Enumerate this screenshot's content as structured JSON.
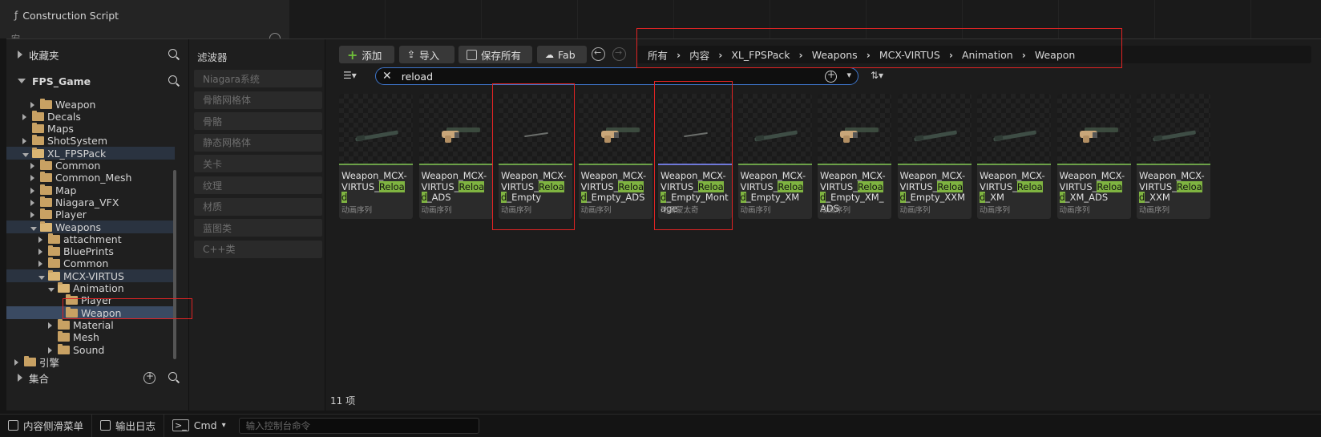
{
  "background": {
    "construction_script": "Construction Script",
    "partial_label": "宏"
  },
  "tree": {
    "favorites": "收藏夹",
    "root": "FPS_Game",
    "rows": [
      {
        "label": "Weapon",
        "indent": 3,
        "arrow": "r",
        "open": false
      },
      {
        "label": "Decals",
        "indent": 2,
        "arrow": "r",
        "open": false
      },
      {
        "label": "Maps",
        "indent": 2,
        "arrow": "",
        "open": false
      },
      {
        "label": "ShotSystem",
        "indent": 2,
        "arrow": "r",
        "open": false
      },
      {
        "label": "XL_FPSPack",
        "indent": 2,
        "arrow": "d",
        "open": true
      },
      {
        "label": "Common",
        "indent": 3,
        "arrow": "r",
        "open": false
      },
      {
        "label": "Common_Mesh",
        "indent": 3,
        "arrow": "r",
        "open": false
      },
      {
        "label": "Map",
        "indent": 3,
        "arrow": "r",
        "open": false
      },
      {
        "label": "Niagara_VFX",
        "indent": 3,
        "arrow": "r",
        "open": false
      },
      {
        "label": "Player",
        "indent": 3,
        "arrow": "r",
        "open": false
      },
      {
        "label": "Weapons",
        "indent": 3,
        "arrow": "d",
        "open": true
      },
      {
        "label": "attachment",
        "indent": 4,
        "arrow": "r",
        "open": false
      },
      {
        "label": "BluePrints",
        "indent": 4,
        "arrow": "r",
        "open": false
      },
      {
        "label": "Common",
        "indent": 4,
        "arrow": "r",
        "open": false
      },
      {
        "label": "MCX-VIRTUS",
        "indent": 4,
        "arrow": "d",
        "open": true
      },
      {
        "label": "Animation",
        "indent": 5,
        "arrow": "d",
        "open": true
      },
      {
        "label": "Player",
        "indent": 6,
        "arrow": "",
        "open": false
      },
      {
        "label": "Weapon",
        "indent": 6,
        "arrow": "",
        "open": false
      },
      {
        "label": "Material",
        "indent": 5,
        "arrow": "r",
        "open": false
      },
      {
        "label": "Mesh",
        "indent": 5,
        "arrow": "",
        "open": false
      },
      {
        "label": "Sound",
        "indent": 5,
        "arrow": "r",
        "open": false
      },
      {
        "label": "引擎",
        "indent": 1,
        "arrow": "r",
        "open": false
      }
    ],
    "collections": "集合"
  },
  "filters": {
    "title": "滤波器",
    "items": [
      "Niagara系统",
      "骨骼网格体",
      "骨骼",
      "静态网格体",
      "关卡",
      "纹理",
      "材质",
      "蓝图类",
      "C++类"
    ]
  },
  "toolbar": {
    "add": "添加",
    "import": "导入",
    "save_all": "保存所有",
    "fab": "Fab"
  },
  "breadcrumbs": [
    "所有",
    "内容",
    "XL_FPSPack",
    "Weapons",
    "MCX-VIRTUS",
    "Animation",
    "Weapon"
  ],
  "search": {
    "value": "reload"
  },
  "assets": [
    {
      "pre": "Weapon_MCX-VIRTUS_",
      "hl": "Reload",
      "post": "",
      "type": "动画序列",
      "gun": "long"
    },
    {
      "pre": "Weapon_MCX-VIRTUS_",
      "hl": "Reload",
      "post": "_ADS",
      "type": "动画序列",
      "gun": "held"
    },
    {
      "pre": "Weapon_MCX-VIRTUS_",
      "hl": "Reload",
      "post": "_Empty",
      "type": "动画序列",
      "gun": "small"
    },
    {
      "pre": "Weapon_MCX-VIRTUS_",
      "hl": "Reload",
      "post": "_Empty_ADS",
      "type": "动画序列",
      "gun": "held"
    },
    {
      "pre": "Weapon_MCX-VIRTUS_",
      "hl": "Reload",
      "post": "_Empty_Montage",
      "type": "动画蒙太奇",
      "gun": "small"
    },
    {
      "pre": "Weapon_MCX-VIRTUS_",
      "hl": "Reload",
      "post": "_Empty_XM",
      "type": "动画序列",
      "gun": "long"
    },
    {
      "pre": "Weapon_MCX-VIRTUS_",
      "hl": "Reload",
      "post": "_Empty_XM_ADS",
      "type": "动画序列",
      "gun": "held"
    },
    {
      "pre": "Weapon_MCX-VIRTUS_",
      "hl": "Reload",
      "post": "_Empty_XXM",
      "type": "动画序列",
      "gun": "long"
    },
    {
      "pre": "Weapon_MCX-VIRTUS_",
      "hl": "Reload",
      "post": "_XM",
      "type": "动画序列",
      "gun": "long"
    },
    {
      "pre": "Weapon_MCX-VIRTUS_",
      "hl": "Reload",
      "post": "_XM_ADS",
      "type": "动画序列",
      "gun": "held"
    },
    {
      "pre": "Weapon_MCX-VIRTUS_",
      "hl": "Reload",
      "post": "_XXM",
      "type": "动画序列",
      "gun": "long"
    }
  ],
  "item_count": "11 项",
  "status": {
    "content_drawer": "内容侧滑菜单",
    "output_log": "输出日志",
    "cmd": "Cmd",
    "cmd_placeholder": "输入控制台命令"
  },
  "colors": {
    "highlight": "#7fb441",
    "annotation": "#e02424",
    "search_border": "#3d74c9"
  }
}
